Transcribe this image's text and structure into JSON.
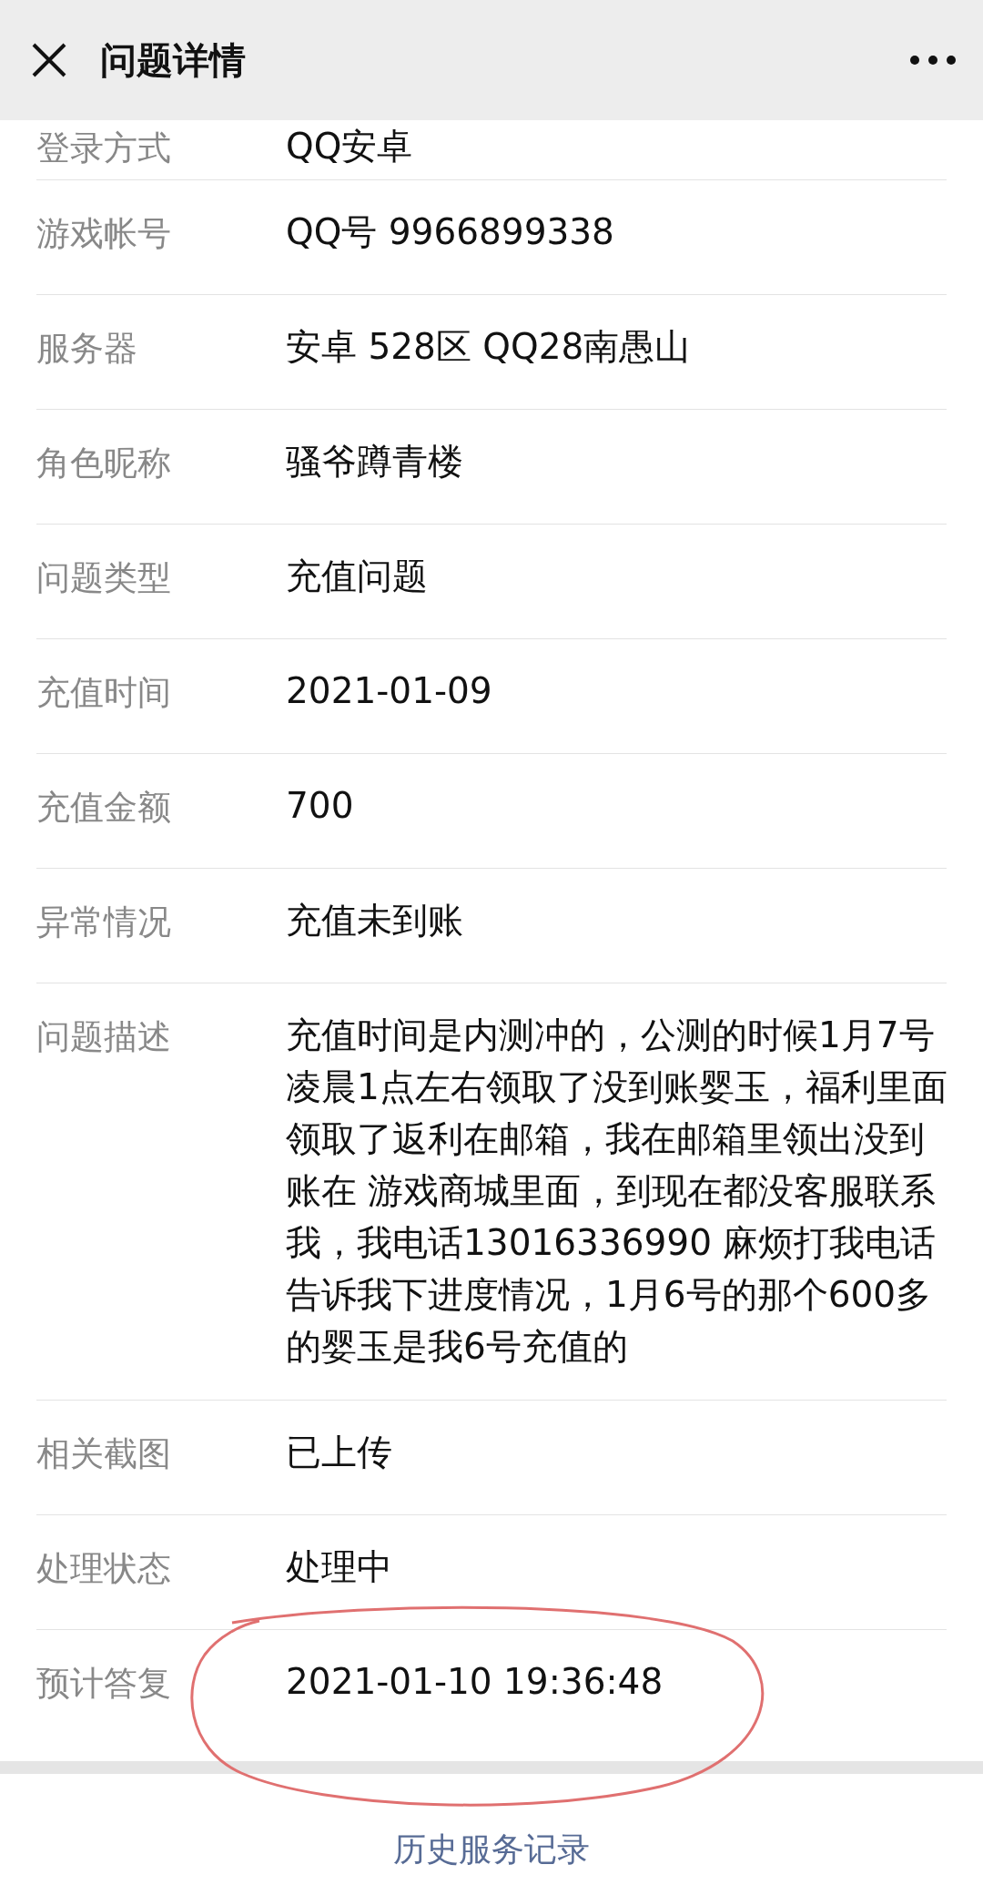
{
  "header": {
    "title": "问题详情"
  },
  "fields": [
    {
      "label": "登录方式",
      "value": "QQ安卓"
    },
    {
      "label": "游戏帐号",
      "value": "QQ号 9966899338"
    },
    {
      "label": "服务器",
      "value": "安卓 528区 QQ28南愚山"
    },
    {
      "label": "角色昵称",
      "value": "骚爷蹲青楼"
    },
    {
      "label": "问题类型",
      "value": "充值问题"
    },
    {
      "label": "充值时间",
      "value": "2021-01-09"
    },
    {
      "label": "充值金额",
      "value": "700"
    },
    {
      "label": "异常情况",
      "value": "充值未到账"
    },
    {
      "label": "问题描述",
      "value": "充值时间是内测冲的，公测的时候1月7号凌晨1点左右领取了没到账婴玉，福利里面领取了返利在邮箱，我在邮箱里领出没到账在 游戏商城里面，到现在都没客服联系我，我电话13016336990 麻烦打我电话告诉我下进度情况，1月6号的那个600多的婴玉是我6号充值的"
    },
    {
      "label": "相关截图",
      "value": "已上传"
    },
    {
      "label": "处理状态",
      "value": "处理中"
    },
    {
      "label": "预计答复",
      "value": "2021-01-10 19:36:48"
    }
  ],
  "footer": {
    "link": "历史服务记录"
  }
}
